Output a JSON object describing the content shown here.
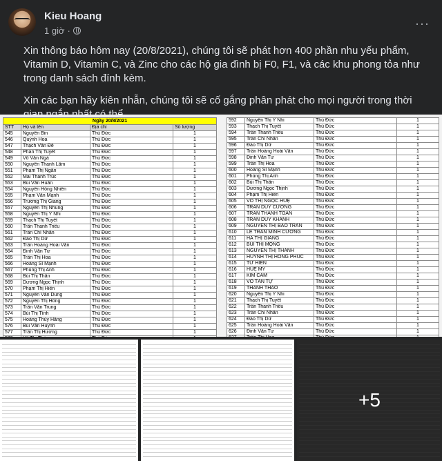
{
  "post": {
    "author": "Kieu Hoang",
    "time": "1 giờ",
    "dot": "·",
    "more": "···",
    "paragraphs": [
      "Xin thông báo hôm nay (20/8/2021), chúng tôi sẽ phát hơn 400 phần nhu yếu phẩm, Vitamin D, Vitamin C, và Zinc cho các hộ gia đình bị F0, F1, và các khu phong tỏa như trong danh sách đính kèm.",
      "Xin các bạn hãy kiên nhẫn, chúng tôi sẽ cố gắng phân phát cho mọi người trong thời gian ngắn nhất có thể."
    ]
  },
  "sheet_left": {
    "title": "Ngày 20/8/2021",
    "headers": [
      "STT",
      "Họ và tên",
      "Địa chỉ",
      "Số lượng"
    ],
    "rows": [
      [
        "545",
        "Nguyễn Bin",
        "Thủ Đức",
        "1"
      ],
      [
        "546",
        "Quỳnh Hoa",
        "Thủ Đức",
        "1"
      ],
      [
        "547",
        "Thạch Văn Đê",
        "Thủ Đức",
        "1"
      ],
      [
        "548",
        "Phan Thị Tuyết",
        "Thủ Đức",
        "1"
      ],
      [
        "549",
        "Võ Văn Ngà",
        "Thủ Đức",
        "1"
      ],
      [
        "550",
        "Nguyễn Thanh Lâm",
        "Thủ Đức",
        "1"
      ],
      [
        "551",
        "Phạm Thị Ngân",
        "Thủ Đức",
        "1"
      ],
      [
        "552",
        "Mai Thanh Trúc",
        "Thủ Đức",
        "1"
      ],
      [
        "553",
        "Bùi Văn Huân",
        "Thủ Đức",
        "1"
      ],
      [
        "554",
        "Nguyễn Hồng Nhiên",
        "Thủ Đức",
        "1"
      ],
      [
        "555",
        "Phạm Văn Mạnh",
        "Thủ Đức",
        "1"
      ],
      [
        "556",
        "Trương Thị Giang",
        "Thủ Đức",
        "1"
      ],
      [
        "557",
        "Nguyễn Thị Nhung",
        "Thủ Đức",
        "1"
      ],
      [
        "558",
        "Nguyễn Thị Ý Nhi",
        "Thủ Đức",
        "1"
      ],
      [
        "559",
        "Thạch Thị Tuyết",
        "Thủ Đức",
        "1"
      ],
      [
        "560",
        "Trần Thanh Triều",
        "Thủ Đức",
        "1"
      ],
      [
        "561",
        "Trần Chí Nhân",
        "Thủ Đức",
        "1"
      ],
      [
        "562",
        "Đào Thị Dữ",
        "Thủ Đức",
        "1"
      ],
      [
        "563",
        "Trần Hoàng Hoài Văn",
        "Thủ Đức",
        "1"
      ],
      [
        "564",
        "Đinh Văn Tư",
        "Thủ Đức",
        "1"
      ],
      [
        "565",
        "Trần Thị Hoa",
        "Thủ Đức",
        "1"
      ],
      [
        "566",
        "Hoàng Sĩ Mạnh",
        "Thủ Đức",
        "1"
      ],
      [
        "567",
        "Phùng Thị Anh",
        "Thủ Đức",
        "1"
      ],
      [
        "568",
        "Bùi Thị Thân",
        "Thủ Đức",
        "1"
      ],
      [
        "569",
        "Dương Ngọc Thịnh",
        "Thủ Đức",
        "1"
      ],
      [
        "570",
        "Phạm Thị Hiền",
        "Thủ Đức",
        "1"
      ],
      [
        "571",
        "Nguyễn Văn Dung",
        "Thủ Đức",
        "1"
      ],
      [
        "572",
        "Nguyễn Thị Hồng",
        "Thủ Đức",
        "1"
      ],
      [
        "573",
        "Trần Văn Trung",
        "Thủ Đức",
        "1"
      ],
      [
        "574",
        "Bùi Thị Tình",
        "Thủ Đức",
        "1"
      ],
      [
        "575",
        "Hoàng Thúy Hằng",
        "Thủ Đức",
        "1"
      ],
      [
        "576",
        "Bùi Văn Huỳnh",
        "Thủ Đức",
        "1"
      ],
      [
        "577",
        "Trần Thị Hương",
        "Thủ Đức",
        "1"
      ],
      [
        "578",
        "Võ Thị Thảo",
        "Thủ Đức",
        "1"
      ],
      [
        "579",
        "Trần Thị Nhan",
        "Thủ Đức",
        "1"
      ]
    ]
  },
  "sheet_right": {
    "rows": [
      [
        "592",
        "Nguyễn Thị Ý Nhi",
        "Thủ Đức",
        "1"
      ],
      [
        "593",
        "Thạch Thị Tuyết",
        "Thủ Đức",
        "1"
      ],
      [
        "594",
        "Trần Thanh Triều",
        "Thủ Đức",
        "1"
      ],
      [
        "595",
        "Trần Chí Nhân",
        "Thủ Đức",
        "1"
      ],
      [
        "596",
        "Đào Thị Dữ",
        "Thủ Đức",
        "1"
      ],
      [
        "597",
        "Trần Hoàng Hoài Văn",
        "Thủ Đức",
        "1"
      ],
      [
        "598",
        "Đinh Văn Tư",
        "Thủ Đức",
        "1"
      ],
      [
        "599",
        "Trần Thị Hoa",
        "Thủ Đức",
        "1"
      ],
      [
        "600",
        "Hoàng Sĩ Mạnh",
        "Thủ Đức",
        "1"
      ],
      [
        "601",
        "Phùng Thị Anh",
        "Thủ Đức",
        "1"
      ],
      [
        "602",
        "Bùi Thị Thân",
        "Thủ Đức",
        "1"
      ],
      [
        "603",
        "Dương Ngọc Thịnh",
        "Thủ Đức",
        "1"
      ],
      [
        "604",
        "Phạm Thị Hiền",
        "Thủ Đức",
        "1"
      ],
      [
        "605",
        "VÕ THỊ NGỌC HUỆ",
        "Thủ Đức",
        "1"
      ],
      [
        "606",
        "TRẦN DUY CƯỜNG",
        "Thủ Đức",
        "1"
      ],
      [
        "607",
        "TRẦN THANH TOÀN",
        "Thủ Đức",
        "1"
      ],
      [
        "608",
        "TRẦN DUY KHÁNH",
        "Thủ Đức",
        "1"
      ],
      [
        "609",
        "NGUYỄN THỊ BẢO TRÂN",
        "Thủ Đức",
        "1"
      ],
      [
        "610",
        "LÊ TRẦN MINH CƯỜNG",
        "Thủ Đức",
        "1"
      ],
      [
        "611",
        "HÀ THỊ GIANG",
        "Thủ Đức",
        "1"
      ],
      [
        "612",
        "BÙI THỊ MỘNG",
        "Thủ Đức",
        "1"
      ],
      [
        "613",
        "NGUYỄN THỊ THANH",
        "Thủ Đức",
        "1"
      ],
      [
        "614",
        "HUỲNH THỊ HỒNG PHÚC",
        "Thủ Đức",
        "1"
      ],
      [
        "615",
        "TỪ HIỂN",
        "Thủ Đức",
        "1"
      ],
      [
        "616",
        "HUỆ MỸ",
        "Thủ Đức",
        "1"
      ],
      [
        "617",
        "KIM CẦM",
        "Thủ Đức",
        "1"
      ],
      [
        "618",
        "VÕ TẤN TỰ",
        "Thủ Đức",
        "1"
      ],
      [
        "619",
        "THANH THẢO",
        "Thủ Đức",
        "1"
      ],
      [
        "620",
        "Nguyễn Thị Ý Nhi",
        "Thủ Đức",
        "1"
      ],
      [
        "621",
        "Thạch Thị Tuyết",
        "Thủ Đức",
        "1"
      ],
      [
        "622",
        "Trần Thanh Triều",
        "Thủ Đức",
        "1"
      ],
      [
        "623",
        "Trần Chí Nhân",
        "Thủ Đức",
        "1"
      ],
      [
        "624",
        "Đào Thị Dữ",
        "Thủ Đức",
        "1"
      ],
      [
        "625",
        "Trần Hoàng Hoài Văn",
        "Thủ Đức",
        "1"
      ],
      [
        "626",
        "Đinh Văn Tư",
        "Thủ Đức",
        "1"
      ],
      [
        "627",
        "Trần Thị Hoa",
        "Thủ Đức",
        "1"
      ],
      [
        "628",
        "Hoàng Sĩ Mạnh",
        "Thủ Đức",
        "1"
      ],
      [
        "629",
        "TRẦN HỮU PHÁT",
        "Thủ Đức",
        "1"
      ]
    ]
  },
  "more_photos": "+5"
}
